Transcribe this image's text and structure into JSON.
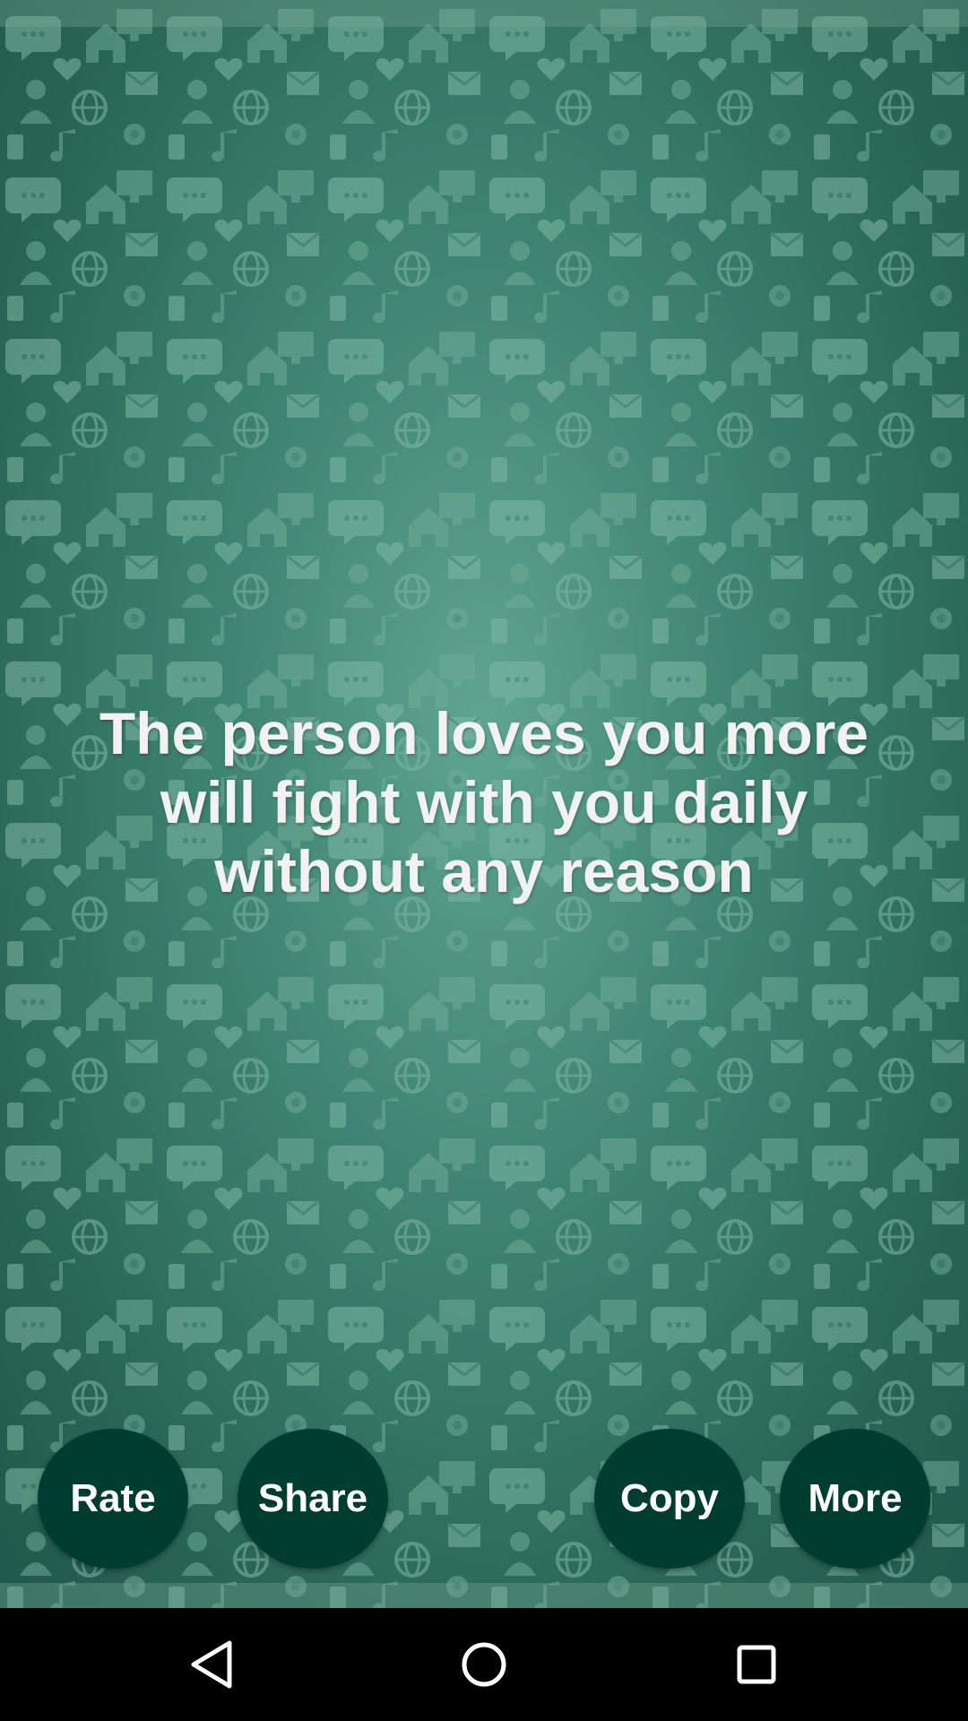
{
  "quote": {
    "text": "The person loves you more will fight with you daily without any reason"
  },
  "actions": {
    "rate_label": "Rate",
    "share_label": "Share",
    "copy_label": "Copy",
    "more_label": "More"
  },
  "navigation": {
    "back_icon": "back-triangle-icon",
    "home_icon": "home-circle-icon",
    "recents_icon": "recents-square-icon"
  },
  "colors": {
    "background": "#3f8472",
    "button_fill": "#003d2e",
    "button_text": "#ffffff",
    "quote_text": "#f2f2f2",
    "nav_bar": "#000000",
    "nav_icon": "#ffffff"
  }
}
